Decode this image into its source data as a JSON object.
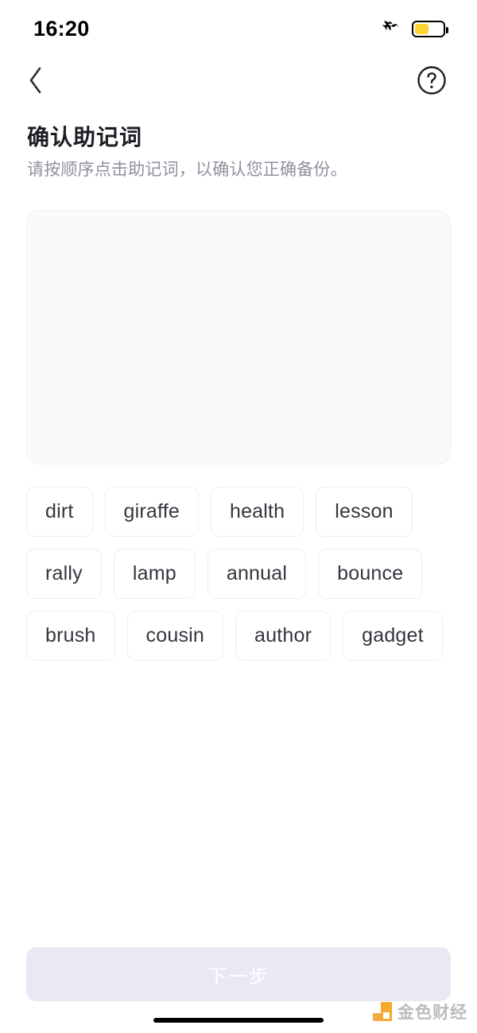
{
  "status_bar": {
    "time": "16:20",
    "airplane_icon": "airplane-mode-icon",
    "battery_icon": "battery-icon",
    "battery_level_percent": 44,
    "battery_color": "#fcd535"
  },
  "nav": {
    "back_icon": "chevron-left-icon",
    "help_icon": "question-mark-circle-icon"
  },
  "page": {
    "title": "确认助记词",
    "subtitle": "请按顺序点击助记词，以确认您正确备份。"
  },
  "answer_card": {
    "selected_words": [],
    "background_color": "#fafafb"
  },
  "word_pool": {
    "words": [
      "dirt",
      "giraffe",
      "health",
      "lesson",
      "rally",
      "lamp",
      "annual",
      "bounce",
      "brush",
      "cousin",
      "author",
      "gadget"
    ]
  },
  "footer": {
    "next_button_label": "下一步",
    "next_button_enabled": false,
    "next_button_color": "#e9e9f6"
  },
  "watermark": {
    "text": "金色财经",
    "accent_color": "#f5a623"
  }
}
